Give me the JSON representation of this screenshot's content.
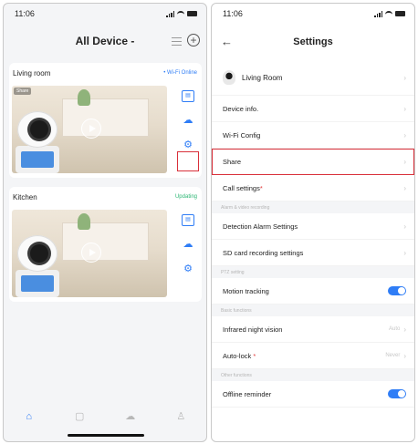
{
  "left": {
    "status": {
      "time": "11:06"
    },
    "header": {
      "title": "All Device -"
    },
    "devices": [
      {
        "name": "Living room",
        "status": "• Wi-Fi Online",
        "badge": "Share"
      },
      {
        "name": "Kitchen",
        "status": "Updating"
      }
    ],
    "tabs": [
      "home-icon",
      "message-icon",
      "cloud-icon",
      "profile-icon"
    ]
  },
  "right": {
    "status": {
      "time": "11:06"
    },
    "header": {
      "title": "Settings"
    },
    "device_row": {
      "name": "Living Room"
    },
    "rows": {
      "device_info": "Device info.",
      "wifi_config": "Wi-Fi Config",
      "share": "Share",
      "call_settings": "Call settings",
      "section_alarm": "Alarm & video recording",
      "detection_alarm": "Detection Alarm Settings",
      "sd_card": "SD card recording settings",
      "section_ptz": "PTZ setting",
      "motion_tracking": "Motion tracking",
      "section_basic": "Basic functions",
      "infrared": "Infrared night vision",
      "infrared_value": "Auto",
      "auto_lock": "Auto-lock",
      "auto_lock_value": "Never",
      "section_other": "Other functions",
      "offline": "Offline reminder"
    },
    "toggles": {
      "motion_tracking": true,
      "offline_reminder": true
    }
  },
  "colors": {
    "accent": "#2f7df6",
    "highlight": "#d9303a",
    "online": "#2bb673"
  }
}
